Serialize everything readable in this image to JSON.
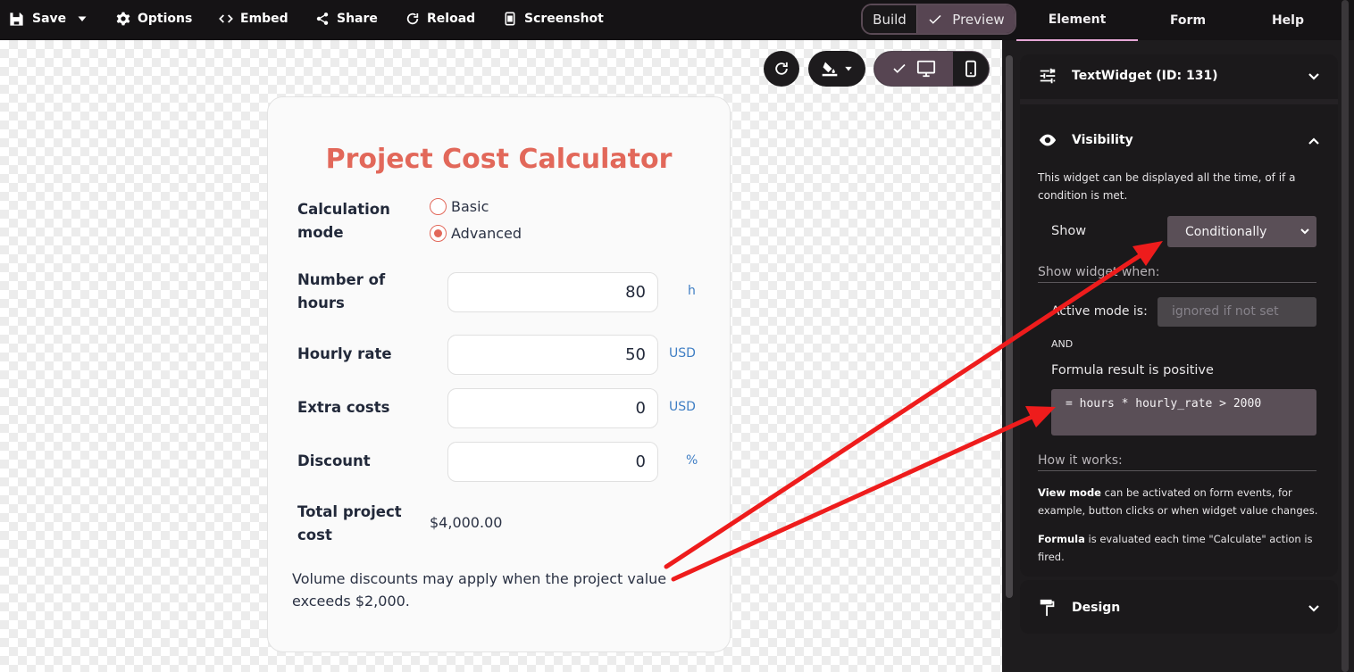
{
  "toolbar": {
    "save": "Save",
    "options": "Options",
    "embed": "Embed",
    "share": "Share",
    "reload": "Reload",
    "screenshot": "Screenshot",
    "build": "Build",
    "preview": "Preview"
  },
  "tabs": {
    "element": "Element",
    "form": "Form",
    "help": "Help"
  },
  "calculator": {
    "title": "Project Cost Calculator",
    "mode_label": "Calculation mode",
    "mode_options": [
      "Basic",
      "Advanced"
    ],
    "mode_selected": "Advanced",
    "hours_label": "Number of hours",
    "hours_value": "80",
    "hours_unit": "h",
    "rate_label": "Hourly rate",
    "rate_value": "50",
    "rate_unit": "USD",
    "extra_label": "Extra costs",
    "extra_value": "0",
    "extra_unit": "USD",
    "discount_label": "Discount",
    "discount_value": "0",
    "discount_unit": "%",
    "total_label": "Total project cost",
    "total_value": "$4,000.00",
    "note": "Volume discounts may apply when the project value exceeds $2,000."
  },
  "panel": {
    "widget_title": "TextWidget (ID: 131)",
    "visibility_title": "Visibility",
    "visibility_desc": "This widget can be displayed all the time, of if a condition is met.",
    "show_label": "Show",
    "show_value": "Conditionally",
    "show_when": "Show widget when:",
    "active_mode_label": "Active mode is:",
    "active_mode_placeholder": "ignored if not set",
    "and": "AND",
    "formula_label": "Formula result is positive",
    "formula": "= hours * hourly_rate > 2000",
    "how_title": "How it works:",
    "how_view_bold": "View mode",
    "how_view_text": " can be activated on form events, for example, button clicks or when widget value changes.",
    "how_formula_bold": "Formula",
    "how_formula_text": " is evaluated each time \"Calculate\" action is fired.",
    "design_title": "Design"
  },
  "colors": {
    "accent": "#e2685a",
    "unit": "#3f7ec4",
    "arrow": "#ee1c1c"
  }
}
